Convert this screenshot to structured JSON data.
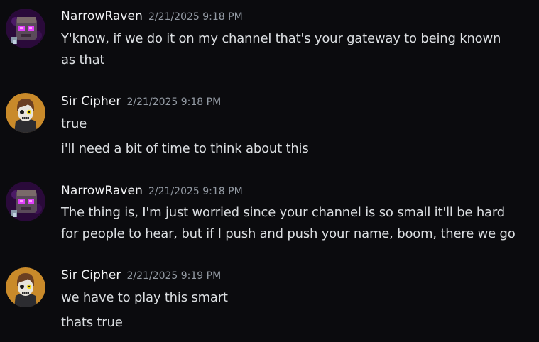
{
  "messages": [
    {
      "author": "NarrowRaven",
      "timestamp": "2/21/2025 9:18 PM",
      "avatar_icon": "narrowraven-avatar-icon",
      "lines": [
        "Y'know, if we do it on my channel that's your gateway to being known",
        "as that"
      ]
    },
    {
      "author": "Sir Cipher",
      "timestamp": "2/21/2025 9:18 PM",
      "avatar_icon": "sircipher-avatar-icon",
      "lines": [
        "true",
        "i'll need a bit of time to think about this"
      ]
    },
    {
      "author": "NarrowRaven",
      "timestamp": "2/21/2025 9:18 PM",
      "avatar_icon": "narrowraven-avatar-icon",
      "lines": [
        "The thing is, I'm just worried since your channel is so small it'll be hard",
        "for people to hear, but if I push and push your name, boom, there we go"
      ]
    },
    {
      "author": "Sir Cipher",
      "timestamp": "2/21/2025 9:19 PM",
      "avatar_icon": "sircipher-avatar-icon",
      "lines": [
        "we have to play this smart",
        "thats true"
      ]
    }
  ],
  "colors": {
    "background": "#0b0b0e",
    "username": "#f2f3f5",
    "timestamp": "#949ba4",
    "text": "#dbdee1",
    "raven_avatar_bg": "#2a0a3a",
    "raven_eyes": "#e040fb",
    "cipher_avatar_bg": "#c98a2a"
  }
}
